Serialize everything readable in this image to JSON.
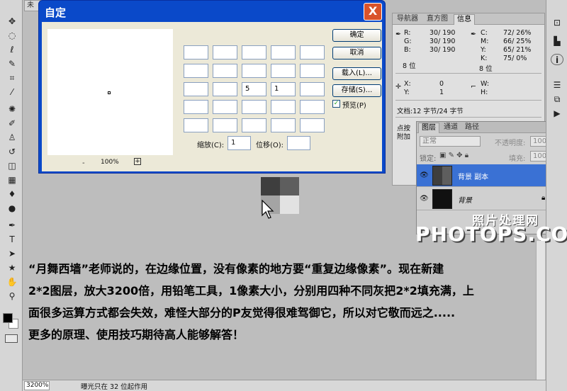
{
  "document_tab": "未",
  "dialog": {
    "title": "自定",
    "close_label": "X",
    "zoom_minus": "-",
    "zoom_value": "100%",
    "zoom_plus": "+",
    "matrix": [
      [
        "",
        "",
        "",
        "",
        ""
      ],
      [
        "",
        "",
        "",
        "",
        ""
      ],
      [
        "",
        "",
        "5",
        "1",
        ""
      ],
      [
        "",
        "",
        "",
        "",
        ""
      ],
      [
        "",
        "",
        "",
        "",
        ""
      ]
    ],
    "scale_label": "缩放(C):",
    "scale_value": "1",
    "offset_label": "位移(O):",
    "offset_value": "",
    "buttons": {
      "ok": "确定",
      "cancel": "取消",
      "load": "载入(L)...",
      "save": "存储(S)..."
    },
    "preview_label": "预览(P)",
    "preview_checked": true
  },
  "info_panel": {
    "tabs": [
      "导航器",
      "直方图",
      "信息"
    ],
    "active_tab": "信息",
    "rgb": {
      "r": "30/ 190",
      "g": "30/ 190",
      "b": "30/ 190",
      "bits": "8 位"
    },
    "cmyk": {
      "c": "72/ 26%",
      "m": "66/ 25%",
      "y": "65/ 21%",
      "k": "75/ 0%",
      "bits": "8 位"
    },
    "xy": {
      "x": "0",
      "y": "1"
    },
    "wh": {
      "w": "",
      "h": ""
    },
    "doc_info": "文档:12 字节/24 字节",
    "hint_line1": "点按",
    "hint_line2": "附加"
  },
  "layers_panel": {
    "tabs": [
      "图层",
      "通道",
      "路径"
    ],
    "active_tab": "图层",
    "blend_mode": "正常",
    "opacity_label": "不透明度:",
    "opacity_value": "100%",
    "lock_label": "锁定:",
    "fill_label": "填充:",
    "fill_value": "100%",
    "layers": [
      {
        "name": "背景 副本",
        "selected": true
      },
      {
        "name": "背景",
        "selected": false,
        "locked": true
      }
    ]
  },
  "canvas_pixels": {
    "colors": [
      "#3e3e3e",
      "#5e5e5e",
      "#a4a4a4",
      "#e2e2e2"
    ]
  },
  "watermark": {
    "line1": "照片处理网",
    "line2": "PHOTOPS.COM"
  },
  "note": {
    "lines": [
      "“月舞西墙”老师说的，在边缘位置，没有像素的地方要“重复边缘像素”。现在新建",
      "2*2图层，放大3200倍，用铅笔工具，1像素大小，分别用四种不同灰把2*2填充满，上",
      "面很多运算方式都会失效，难怪大部分的P友觉得很难驾御它，所以对它敬而远之.....",
      "更多的原理、使用技巧期待高人能够解答！"
    ]
  },
  "statusbar": {
    "zoom": "3200%",
    "text": "曝光只在 32 位起作用"
  }
}
